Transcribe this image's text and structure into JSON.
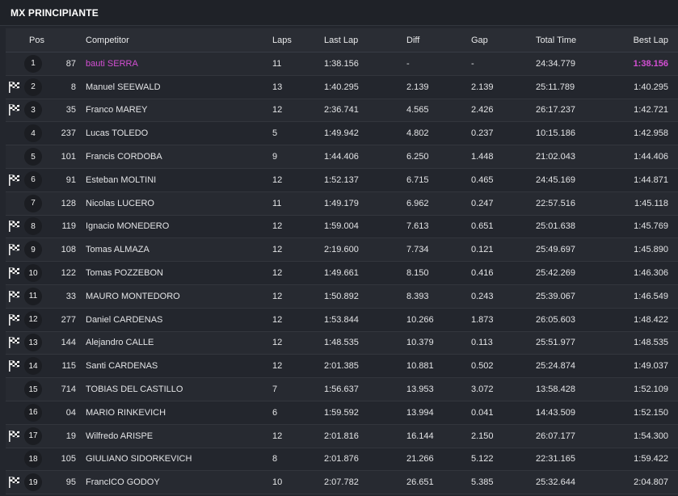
{
  "title": "MX PRINCIPIANTE",
  "headers": {
    "pos": "Pos",
    "competitor": "Competitor",
    "laps": "Laps",
    "last_lap": "Last Lap",
    "diff": "Diff",
    "gap": "Gap",
    "total_time": "Total Time",
    "best_lap": "Best Lap"
  },
  "colors": {
    "highlight": "#d34fd3",
    "background": "#23262d"
  },
  "rows": [
    {
      "flag": false,
      "pos": "1",
      "num": "87",
      "competitor": "bauti SERRA",
      "laps": "11",
      "last": "1:38.156",
      "diff": "-",
      "gap": "-",
      "total": "24:34.779",
      "best": "1:38.156",
      "leader": true
    },
    {
      "flag": true,
      "pos": "2",
      "num": "8",
      "competitor": "Manuel SEEWALD",
      "laps": "13",
      "last": "1:40.295",
      "diff": "2.139",
      "gap": "2.139",
      "total": "25:11.789",
      "best": "1:40.295"
    },
    {
      "flag": true,
      "pos": "3",
      "num": "35",
      "competitor": "Franco MAREY",
      "laps": "12",
      "last": "2:36.741",
      "diff": "4.565",
      "gap": "2.426",
      "total": "26:17.237",
      "best": "1:42.721"
    },
    {
      "flag": false,
      "pos": "4",
      "num": "237",
      "competitor": "Lucas TOLEDO",
      "laps": "5",
      "last": "1:49.942",
      "diff": "4.802",
      "gap": "0.237",
      "total": "10:15.186",
      "best": "1:42.958"
    },
    {
      "flag": false,
      "pos": "5",
      "num": "101",
      "competitor": "Francis CORDOBA",
      "laps": "9",
      "last": "1:44.406",
      "diff": "6.250",
      "gap": "1.448",
      "total": "21:02.043",
      "best": "1:44.406"
    },
    {
      "flag": true,
      "pos": "6",
      "num": "91",
      "competitor": "Esteban MOLTINI",
      "laps": "12",
      "last": "1:52.137",
      "diff": "6.715",
      "gap": "0.465",
      "total": "24:45.169",
      "best": "1:44.871"
    },
    {
      "flag": false,
      "pos": "7",
      "num": "128",
      "competitor": "Nicolas LUCERO",
      "laps": "11",
      "last": "1:49.179",
      "diff": "6.962",
      "gap": "0.247",
      "total": "22:57.516",
      "best": "1:45.118"
    },
    {
      "flag": true,
      "pos": "8",
      "num": "119",
      "competitor": "Ignacio MONEDERO",
      "laps": "12",
      "last": "1:59.004",
      "diff": "7.613",
      "gap": "0.651",
      "total": "25:01.638",
      "best": "1:45.769"
    },
    {
      "flag": true,
      "pos": "9",
      "num": "108",
      "competitor": "Tomas ALMAZA",
      "laps": "12",
      "last": "2:19.600",
      "diff": "7.734",
      "gap": "0.121",
      "total": "25:49.697",
      "best": "1:45.890"
    },
    {
      "flag": true,
      "pos": "10",
      "num": "122",
      "competitor": "Tomas POZZEBON",
      "laps": "12",
      "last": "1:49.661",
      "diff": "8.150",
      "gap": "0.416",
      "total": "25:42.269",
      "best": "1:46.306"
    },
    {
      "flag": true,
      "pos": "11",
      "num": "33",
      "competitor": "MAURO MONTEDORO",
      "laps": "12",
      "last": "1:50.892",
      "diff": "8.393",
      "gap": "0.243",
      "total": "25:39.067",
      "best": "1:46.549"
    },
    {
      "flag": true,
      "pos": "12",
      "num": "277",
      "competitor": "Daniel CARDENAS",
      "laps": "12",
      "last": "1:53.844",
      "diff": "10.266",
      "gap": "1.873",
      "total": "26:05.603",
      "best": "1:48.422"
    },
    {
      "flag": true,
      "pos": "13",
      "num": "144",
      "competitor": "Alejandro CALLE",
      "laps": "12",
      "last": "1:48.535",
      "diff": "10.379",
      "gap": "0.113",
      "total": "25:51.977",
      "best": "1:48.535"
    },
    {
      "flag": true,
      "pos": "14",
      "num": "115",
      "competitor": "Santi CARDENAS",
      "laps": "12",
      "last": "2:01.385",
      "diff": "10.881",
      "gap": "0.502",
      "total": "25:24.874",
      "best": "1:49.037"
    },
    {
      "flag": false,
      "pos": "15",
      "num": "714",
      "competitor": "TOBIAS DEL CASTILLO",
      "laps": "7",
      "last": "1:56.637",
      "diff": "13.953",
      "gap": "3.072",
      "total": "13:58.428",
      "best": "1:52.109"
    },
    {
      "flag": false,
      "pos": "16",
      "num": "04",
      "competitor": "MARIO RINKEVICH",
      "laps": "6",
      "last": "1:59.592",
      "diff": "13.994",
      "gap": "0.041",
      "total": "14:43.509",
      "best": "1:52.150"
    },
    {
      "flag": true,
      "pos": "17",
      "num": "19",
      "competitor": "Wilfredo ARISPE",
      "laps": "12",
      "last": "2:01.816",
      "diff": "16.144",
      "gap": "2.150",
      "total": "26:07.177",
      "best": "1:54.300"
    },
    {
      "flag": false,
      "pos": "18",
      "num": "105",
      "competitor": "GIULIANO SIDORKEVICH",
      "laps": "8",
      "last": "2:01.876",
      "diff": "21.266",
      "gap": "5.122",
      "total": "22:31.165",
      "best": "1:59.422"
    },
    {
      "flag": true,
      "pos": "19",
      "num": "95",
      "competitor": "FrancICO GODOY",
      "laps": "10",
      "last": "2:07.782",
      "diff": "26.651",
      "gap": "5.385",
      "total": "25:32.644",
      "best": "2:04.807"
    }
  ]
}
